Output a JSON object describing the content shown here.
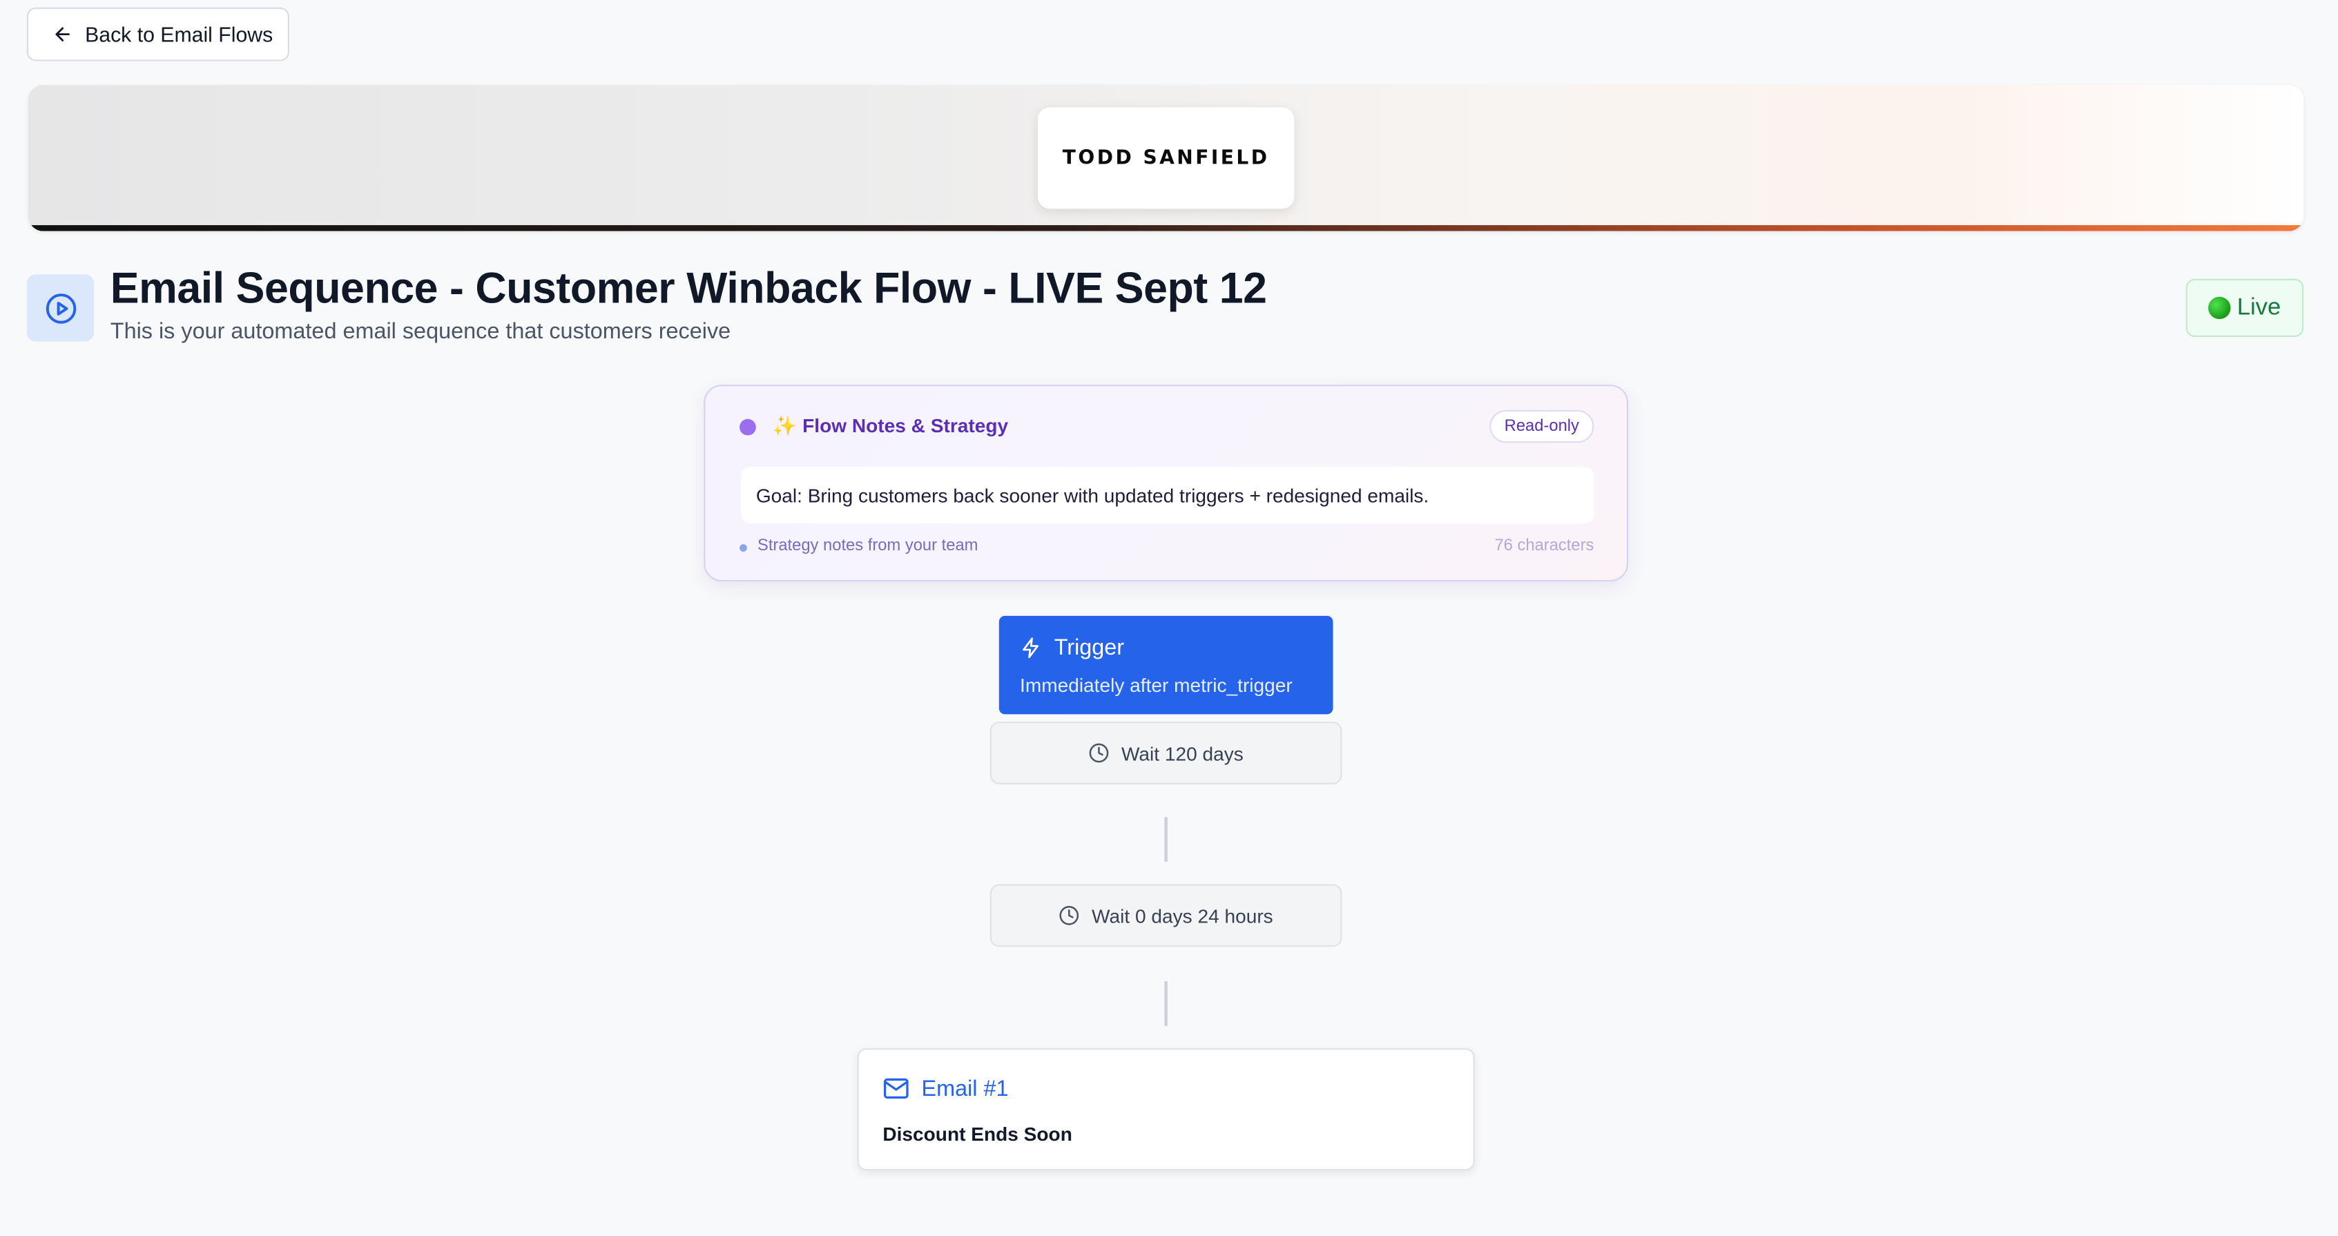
{
  "nav": {
    "back_label": "Back to Email Flows"
  },
  "banner": {
    "logo_text": "TODD SANFIELD"
  },
  "header": {
    "title": "Email Sequence - Customer Winback Flow - LIVE Sept 12",
    "subtitle": "This is your automated email sequence that customers receive",
    "status_label": "Live",
    "status_color": "#157a3c"
  },
  "notes": {
    "sparkle": "✨",
    "title": "Flow Notes & Strategy",
    "badge": "Read-only",
    "goal": "Goal: Bring customers back sooner with updated triggers + redesigned emails.",
    "footer_left": "Strategy notes from your team",
    "footer_right": "76 characters"
  },
  "flow": {
    "trigger": {
      "title": "Trigger",
      "subtitle": "Immediately after metric_trigger",
      "icon": "lightning-icon",
      "color": "#2563eb"
    },
    "waits": [
      {
        "label": "Wait 120 days",
        "icon": "clock-icon"
      },
      {
        "label": "Wait 0 days 24 hours",
        "icon": "clock-icon"
      }
    ],
    "email": {
      "title": "Email #1",
      "subject": "Discount Ends Soon",
      "icon": "mail-icon"
    }
  }
}
